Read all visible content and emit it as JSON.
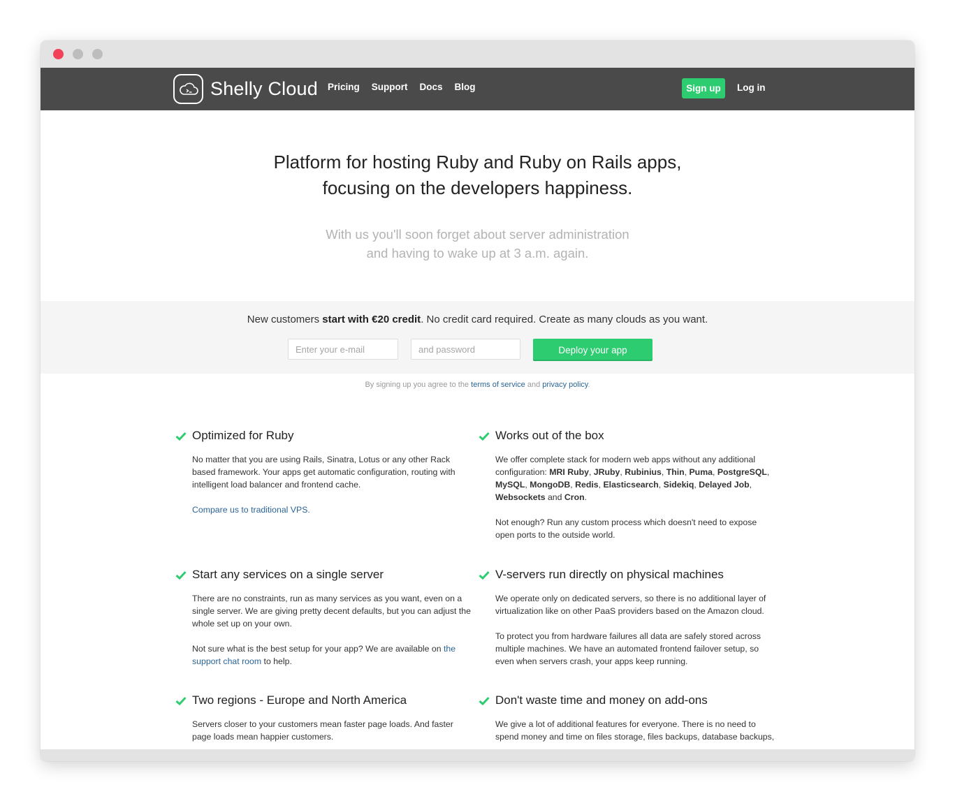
{
  "brand": {
    "name": "Shelly Cloud",
    "logo_icon": "cloud-terminal-icon"
  },
  "nav": {
    "links": [
      "Pricing",
      "Support",
      "Docs",
      "Blog"
    ],
    "signup_label": "Sign up",
    "login_label": "Log in"
  },
  "hero": {
    "title_line1": "Platform for hosting Ruby and Ruby on Rails apps,",
    "title_line2": "focusing on the developers happiness.",
    "sub_line1": "With us you'll soon forget about server administration",
    "sub_line2": "and having to wake up at 3 a.m. again."
  },
  "signup": {
    "offer_prefix": "New customers ",
    "offer_bold": "start with €20 credit",
    "offer_suffix": ". No credit card required. Create as many clouds as you want.",
    "email_placeholder": "Enter your e-mail",
    "password_placeholder": "and password",
    "deploy_label": "Deploy your app",
    "terms_prefix": "By signing up you agree to the ",
    "terms_link": "terms of service",
    "terms_and": " and ",
    "privacy_link": "privacy policy",
    "terms_suffix": "."
  },
  "features": {
    "ruby": {
      "title": "Optimized for Ruby",
      "body": "No matter that you are using Rails, Sinatra, Lotus or any other Rack based framework. Your apps get automatic configuration, routing with intelligent load balancer and frontend cache.",
      "link": "Compare us to traditional VPS",
      "link_suffix": "."
    },
    "box": {
      "title": "Works out of the box",
      "intro": "We offer complete stack for modern web apps without any additional configuration: ",
      "stack": [
        "MRI Ruby",
        "JRuby",
        "Rubinius",
        "Thin",
        "Puma",
        "PostgreSQL",
        "MySQL",
        "MongoDB",
        "Redis",
        "Elasticsearch",
        "Sidekiq",
        "Delayed Job",
        "Websockets",
        "Cron"
      ],
      "sep": ", ",
      "and": " and ",
      "end": ".",
      "more": "Not enough? Run any custom process which doesn't need to expose open ports to the outside world."
    },
    "services": {
      "title": "Start any services on a single server",
      "body": "There are no constraints, run as many services as you want, even on a single server. We are giving pretty decent defaults, but you can adjust the whole set up on your own.",
      "help_prefix": "Not sure what is the best setup for your app? We are available on ",
      "help_link": "the support chat room",
      "help_suffix": " to help."
    },
    "physical": {
      "title": "V-servers run directly on physical machines",
      "body": "We operate only on dedicated servers, so there is no additional layer of virtualization like on other PaaS providers based on the Amazon cloud.",
      "body2": "To protect you from hardware failures all data are safely stored across multiple machines. We have an automated frontend failover setup, so even when servers crash, your apps keep running."
    },
    "regions": {
      "title": "Two regions - Europe and North America",
      "body": "Servers closer to your customers mean faster page loads. And faster page loads mean happier customers."
    },
    "addons": {
      "title": "Don't waste time and money on add-ons",
      "body": "We give a lot of additional features for everyone. There is no need to spend money and time on files storage, files backups, database backups,"
    }
  },
  "colors": {
    "accent_green": "#2ecc71",
    "nav_bg": "#4a4a4a",
    "link_blue": "#2a6496",
    "close_red": "#f2425a"
  }
}
